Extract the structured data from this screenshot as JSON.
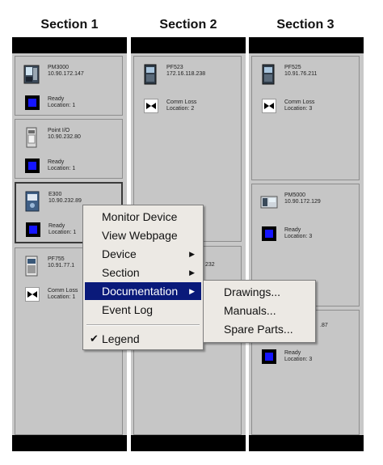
{
  "sections": [
    {
      "title": "Section 1",
      "devices": [
        {
          "name": "PM3000",
          "ip": "10.90.172.147",
          "status": "Ready",
          "location": "Location: 1",
          "kind": "meter",
          "status_type": "ready"
        },
        {
          "name": "Point I/O",
          "ip": "10.90.232.80",
          "status": "Ready",
          "location": "Location: 1",
          "kind": "io",
          "status_type": "ready"
        },
        {
          "name": "E300",
          "ip": "10.90.232.89",
          "status": "Ready",
          "location": "Location: 1",
          "kind": "relay",
          "status_type": "ready"
        },
        {
          "name": "PF755",
          "ip": "10.91.77.1",
          "status": "Comm Loss",
          "location": "Location: 1",
          "kind": "drive",
          "status_type": "comm"
        }
      ]
    },
    {
      "title": "Section 2",
      "devices": [
        {
          "name": "PF523",
          "ip": "172.16.118.238",
          "status": "Comm Loss",
          "location": "Location: 2",
          "kind": "drive",
          "status_type": "comm"
        },
        {
          "name": "",
          "ip": "232",
          "status": "",
          "location": "",
          "kind": "none",
          "status_type": "none"
        }
      ]
    },
    {
      "title": "Section 3",
      "devices": [
        {
          "name": "PF525",
          "ip": "10.91.76.211",
          "status": "Comm Loss",
          "location": "Location: 3",
          "kind": "drive",
          "status_type": "comm"
        },
        {
          "name": "PM5000",
          "ip": "10.90.172.129",
          "status": "Ready",
          "location": "Location: 3",
          "kind": "meter2",
          "status_type": "ready"
        },
        {
          "name": "",
          "ip": ".87",
          "status": "Ready",
          "location": "Location: 3",
          "kind": "none",
          "status_type": "ready"
        }
      ]
    }
  ],
  "context_menu": {
    "items": [
      {
        "label": "Monitor Device",
        "submenu": false
      },
      {
        "label": "View Webpage",
        "submenu": false
      },
      {
        "label": "Device",
        "submenu": true
      },
      {
        "label": "Section",
        "submenu": true
      },
      {
        "label": "Documentation",
        "submenu": true,
        "highlighted": true
      }
    ],
    "event_log": "Event Log",
    "legend": "Legend",
    "legend_checked": true,
    "check_glyph": "✔",
    "arrow_glyph": "▶"
  },
  "documentation_submenu": {
    "items": [
      "Drawings...",
      "Manuals...",
      "Spare Parts..."
    ]
  },
  "colors": {
    "panel": "#c8c8c8",
    "bar": "#000000",
    "ready_blue": "#1515ff",
    "menu_highlight": "#0a1a7a",
    "menu_bg": "#ece9e4"
  }
}
